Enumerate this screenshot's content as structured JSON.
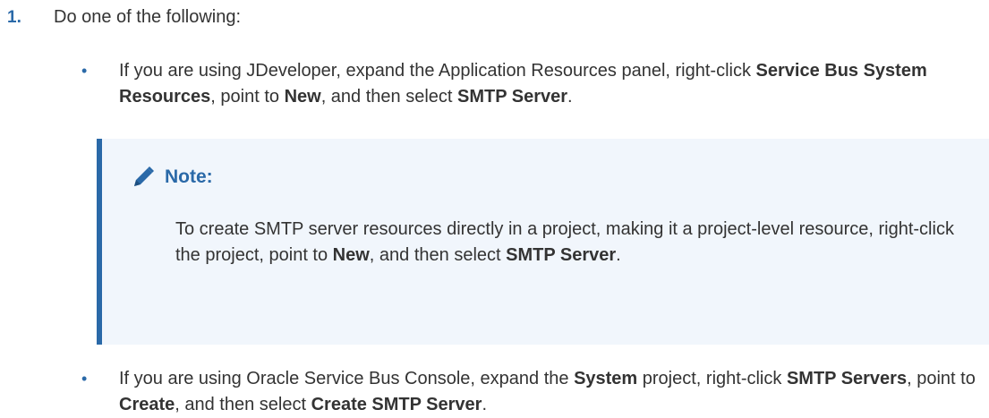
{
  "step": {
    "number": "1.",
    "intro": "Do one of the following:"
  },
  "bullet_symbol": "•",
  "bullet1": {
    "t1": "If you are using JDeveloper, expand the Application Resources panel, right-click ",
    "b1": "Service Bus System Resources",
    "t2": ", point to ",
    "b2": "New",
    "t3": ", and then select ",
    "b3": "SMTP Server",
    "t4": "."
  },
  "note": {
    "icon": "pencil-icon",
    "title": "Note:",
    "t1": "To create SMTP server resources directly in a project, making it a project-level resource, right-click the project, point to ",
    "b1": "New",
    "t2": ", and then select ",
    "b2": "SMTP Server",
    "t3": "."
  },
  "bullet2": {
    "t1": "If you are using Oracle Service Bus Console, expand the ",
    "b1": "System",
    "t2": " project, right-click ",
    "b2": "SMTP Servers",
    "t3": ", point to ",
    "b3": "Create",
    "t4": ", and then select ",
    "b4": "Create SMTP Server",
    "t5": "."
  },
  "colors": {
    "accent": "#2a69a8",
    "text": "#333333",
    "note_background": "#f1f6fc"
  }
}
